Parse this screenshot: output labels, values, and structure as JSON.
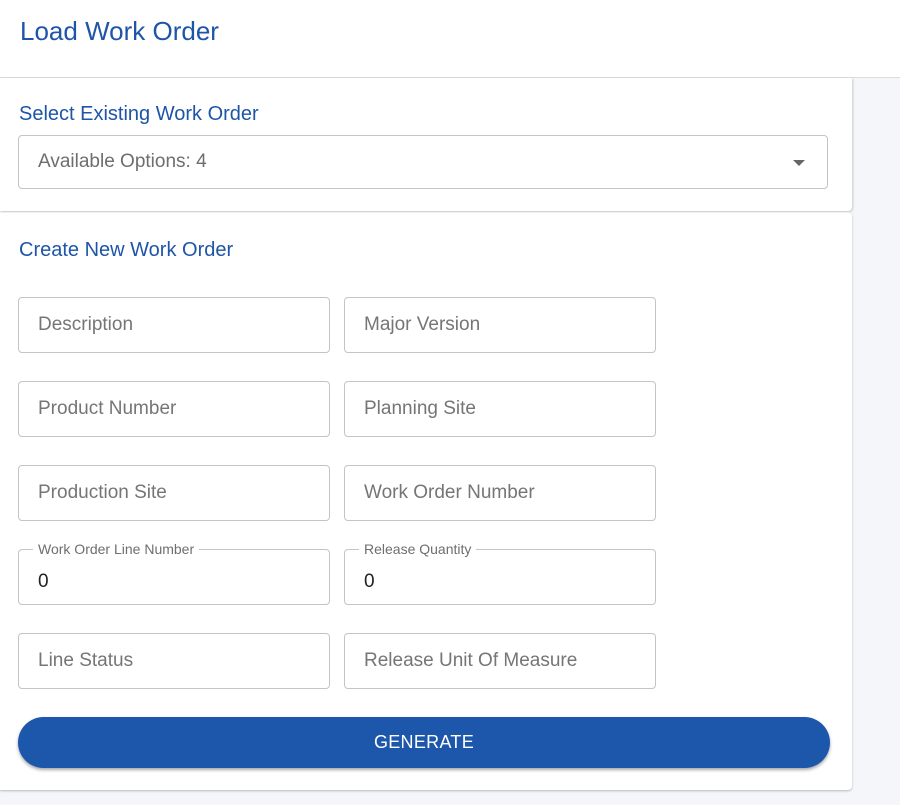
{
  "header": {
    "title": "Load Work Order"
  },
  "select_section": {
    "title": "Select Existing Work Order",
    "select_value": "Available Options: 4"
  },
  "create_section": {
    "title": "Create New Work Order",
    "fields": [
      {
        "placeholder": "Description",
        "value": ""
      },
      {
        "placeholder": "Major Version",
        "value": ""
      },
      {
        "placeholder": "Product Number",
        "value": ""
      },
      {
        "placeholder": "Planning Site",
        "value": ""
      },
      {
        "placeholder": "Production Site",
        "value": ""
      },
      {
        "placeholder": "Work Order Number",
        "value": ""
      },
      {
        "label": "Work Order Line Number",
        "value": "0"
      },
      {
        "label": "Release Quantity",
        "value": "0"
      },
      {
        "placeholder": "Line Status",
        "value": ""
      },
      {
        "placeholder": "Release Unit Of Measure",
        "value": ""
      }
    ],
    "generate_label": "GENERATE"
  },
  "colors": {
    "accent": "#1e55a8",
    "button": "#1c57ab"
  }
}
